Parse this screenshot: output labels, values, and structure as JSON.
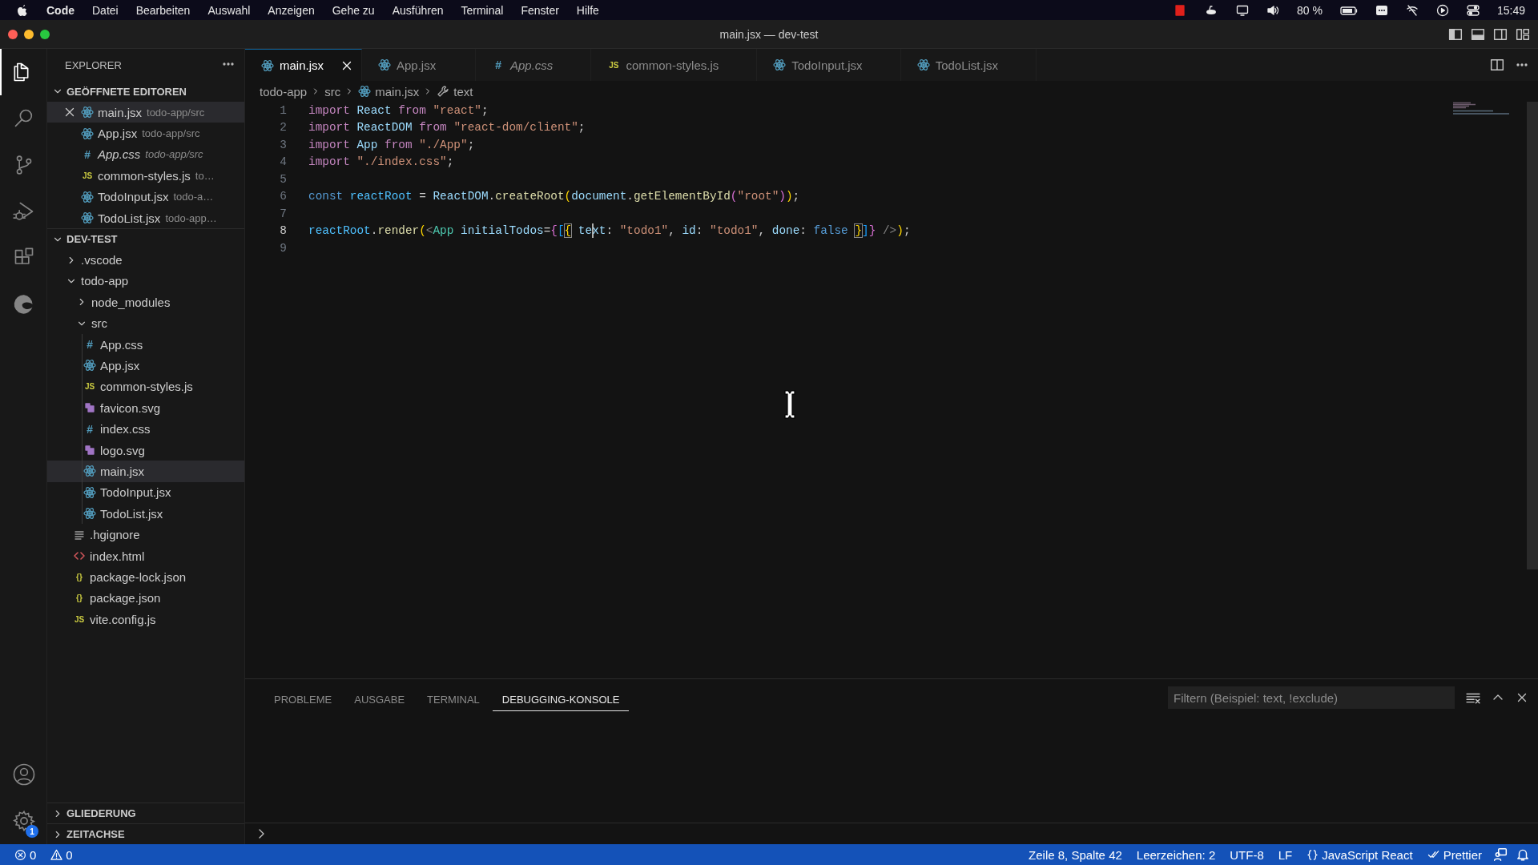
{
  "menubar": {
    "app_name": "Code",
    "menus": [
      "Datei",
      "Bearbeiten",
      "Auswahl",
      "Anzeigen",
      "Gehe zu",
      "Ausführen",
      "Terminal",
      "Fenster",
      "Hilfe"
    ],
    "battery": "80 %",
    "clock": "15:49"
  },
  "window": {
    "title": "main.jsx — dev-test"
  },
  "activity_bar": {
    "items": [
      {
        "kind": "files",
        "selected": true
      },
      {
        "kind": "search",
        "selected": false
      },
      {
        "kind": "source-control",
        "selected": false
      },
      {
        "kind": "run-debug",
        "selected": false
      },
      {
        "kind": "extensions",
        "selected": false
      },
      {
        "kind": "edge",
        "selected": false
      }
    ],
    "settings_badge": "1"
  },
  "sidebar": {
    "title": "EXPLORER",
    "open_editors": {
      "title": "GEÖFFNETE EDITOREN",
      "expanded": true,
      "items": [
        {
          "name": "main.jsx",
          "path": "todo-app/src",
          "kind": "react",
          "selected": true,
          "preview": false
        },
        {
          "name": "App.jsx",
          "path": "todo-app/src",
          "kind": "react",
          "selected": false,
          "preview": false
        },
        {
          "name": "App.css",
          "path": "todo-app/src",
          "kind": "css",
          "icon_text": "#",
          "selected": false,
          "preview": true
        },
        {
          "name": "common-styles.js",
          "path": "to…",
          "kind": "js",
          "icon_text": "JS",
          "selected": false,
          "preview": false
        },
        {
          "name": "TodoInput.jsx",
          "path": "todo-a…",
          "kind": "react",
          "selected": false,
          "preview": false
        },
        {
          "name": "TodoList.jsx",
          "path": "todo-app…",
          "kind": "react",
          "selected": false,
          "preview": false
        }
      ]
    },
    "workspace": {
      "title": "DEV-TEST",
      "expanded": true,
      "items": [
        {
          "name": ".vscode",
          "kind": "folder",
          "expanded": false,
          "selected": false
        },
        {
          "name": "todo-app",
          "kind": "folder",
          "expanded": true,
          "selected": false,
          "children": [
            {
              "name": "node_modules",
              "kind": "folder",
              "expanded": false,
              "selected": false
            },
            {
              "name": "src",
              "kind": "folder",
              "expanded": true,
              "selected": false,
              "children": [
                {
                  "name": "App.css",
                  "kind": "css",
                  "icon_text": "#",
                  "selected": false
                },
                {
                  "name": "App.jsx",
                  "kind": "react",
                  "selected": false
                },
                {
                  "name": "common-styles.js",
                  "kind": "js",
                  "icon_text": "JS",
                  "selected": false
                },
                {
                  "name": "favicon.svg",
                  "kind": "svg",
                  "selected": false
                },
                {
                  "name": "index.css",
                  "kind": "css",
                  "icon_text": "#",
                  "selected": false
                },
                {
                  "name": "logo.svg",
                  "kind": "svg",
                  "selected": false
                },
                {
                  "name": "main.jsx",
                  "kind": "react",
                  "selected": true
                },
                {
                  "name": "TodoInput.jsx",
                  "kind": "react",
                  "selected": false
                },
                {
                  "name": "TodoList.jsx",
                  "kind": "react",
                  "selected": false
                }
              ]
            },
            {
              "name": ".hgignore",
              "kind": "lines",
              "selected": false
            },
            {
              "name": "index.html",
              "kind": "html",
              "selected": false
            },
            {
              "name": "package-lock.json",
              "kind": "json",
              "icon_text": "{}",
              "selected": false
            },
            {
              "name": "package.json",
              "kind": "json",
              "icon_text": "{}",
              "selected": false
            },
            {
              "name": "vite.config.js",
              "kind": "js",
              "icon_text": "JS",
              "selected": false
            }
          ]
        }
      ]
    },
    "sections": [
      {
        "title": "GLIEDERUNG",
        "expanded": false
      },
      {
        "title": "ZEITACHSE",
        "expanded": false
      }
    ]
  },
  "tabs": [
    {
      "label": "main.jsx",
      "kind": "react",
      "selected": true,
      "preview": false
    },
    {
      "label": "App.jsx",
      "kind": "react",
      "selected": false,
      "preview": false
    },
    {
      "label": "App.css",
      "kind": "css",
      "icon_text": "#",
      "selected": false,
      "preview": true
    },
    {
      "label": "common-styles.js",
      "kind": "js",
      "icon_text": "JS",
      "selected": false,
      "preview": false
    },
    {
      "label": "TodoInput.jsx",
      "kind": "react",
      "selected": false,
      "preview": false
    },
    {
      "label": "TodoList.jsx",
      "kind": "react",
      "selected": false,
      "preview": false
    }
  ],
  "breadcrumb": [
    {
      "label": "todo-app",
      "kind": "folder"
    },
    {
      "label": "src",
      "kind": "folder"
    },
    {
      "label": "main.jsx",
      "kind": "react"
    },
    {
      "label": "text",
      "kind": "wrench"
    }
  ],
  "code": [
    {
      "number": "1",
      "active": false,
      "tokens": [
        {
          "t": "import ",
          "kind": "kw"
        },
        {
          "t": "React ",
          "kind": "var"
        },
        {
          "t": "from ",
          "kind": "kw"
        },
        {
          "t": "\"react\"",
          "kind": "str"
        },
        {
          "t": ";",
          "kind": "plain"
        }
      ]
    },
    {
      "number": "2",
      "active": false,
      "tokens": [
        {
          "t": "import ",
          "kind": "kw"
        },
        {
          "t": "ReactDOM ",
          "kind": "var"
        },
        {
          "t": "from ",
          "kind": "kw"
        },
        {
          "t": "\"react-dom/client\"",
          "kind": "str"
        },
        {
          "t": ";",
          "kind": "plain"
        }
      ]
    },
    {
      "number": "3",
      "active": false,
      "tokens": [
        {
          "t": "import ",
          "kind": "kw"
        },
        {
          "t": "App ",
          "kind": "var"
        },
        {
          "t": "from ",
          "kind": "kw"
        },
        {
          "t": "\"./App\"",
          "kind": "str"
        },
        {
          "t": ";",
          "kind": "plain"
        }
      ]
    },
    {
      "number": "4",
      "active": false,
      "tokens": [
        {
          "t": "import ",
          "kind": "kw"
        },
        {
          "t": "\"./index.css\"",
          "kind": "str"
        },
        {
          "t": ";",
          "kind": "plain"
        }
      ]
    },
    {
      "number": "5",
      "active": false
    },
    {
      "number": "6",
      "active": false,
      "tokens": [
        {
          "t": "const ",
          "kind": "decl"
        },
        {
          "t": "reactRoot",
          "kind": "const"
        },
        {
          "t": " = ",
          "kind": "plain"
        },
        {
          "t": "ReactDOM",
          "kind": "var"
        },
        {
          "t": ".",
          "kind": "plain"
        },
        {
          "t": "createRoot",
          "kind": "fn"
        },
        {
          "t": "(",
          "kind": "b1"
        },
        {
          "t": "document",
          "kind": "var"
        },
        {
          "t": ".",
          "kind": "plain"
        },
        {
          "t": "getElementById",
          "kind": "fn"
        },
        {
          "t": "(",
          "kind": "b2"
        },
        {
          "t": "\"root\"",
          "kind": "str"
        },
        {
          "t": ")",
          "kind": "b2"
        },
        {
          "t": ")",
          "kind": "b1"
        },
        {
          "t": ";",
          "kind": "plain"
        }
      ]
    },
    {
      "number": "7",
      "active": false
    },
    {
      "number": "8",
      "active": true,
      "tokens": [
        {
          "t": "reactRoot",
          "kind": "const"
        },
        {
          "t": ".",
          "kind": "plain"
        },
        {
          "t": "render",
          "kind": "fn"
        },
        {
          "t": "(",
          "kind": "b1"
        },
        {
          "t": "<",
          "kind": "punct"
        },
        {
          "t": "App ",
          "kind": "comp"
        },
        {
          "t": "initialTodos",
          "kind": "var"
        },
        {
          "t": "=",
          "kind": "plain"
        },
        {
          "t": "{",
          "kind": "b2"
        },
        {
          "t": "[",
          "kind": "b3"
        },
        {
          "t": "{",
          "kind": "b1m"
        },
        {
          "t": " te",
          "kind": "var"
        },
        {
          "kind": "caret"
        },
        {
          "t": "xt",
          "kind": "var"
        },
        {
          "t": ": ",
          "kind": "plain"
        },
        {
          "t": "\"todo1\"",
          "kind": "str"
        },
        {
          "t": ", ",
          "kind": "plain"
        },
        {
          "t": "id",
          "kind": "var"
        },
        {
          "t": ": ",
          "kind": "plain"
        },
        {
          "t": "\"todo1\"",
          "kind": "str"
        },
        {
          "t": ", ",
          "kind": "plain"
        },
        {
          "t": "done",
          "kind": "var"
        },
        {
          "t": ": ",
          "kind": "plain"
        },
        {
          "t": "false ",
          "kind": "bool"
        },
        {
          "t": "}",
          "kind": "b1m"
        },
        {
          "t": "]",
          "kind": "b3"
        },
        {
          "t": "}",
          "kind": "b2"
        },
        {
          "t": " />",
          "kind": "punct"
        },
        {
          "t": ")",
          "kind": "b1"
        },
        {
          "t": ";",
          "kind": "plain"
        }
      ]
    },
    {
      "number": "9",
      "active": false
    }
  ],
  "panel": {
    "tabs": [
      {
        "label": "PROBLEME",
        "selected": false
      },
      {
        "label": "AUSGABE",
        "selected": false
      },
      {
        "label": "TERMINAL",
        "selected": false
      },
      {
        "label": "DEBUGGING-KONSOLE",
        "selected": true
      }
    ],
    "filter": {
      "placeholder": "Filtern (Beispiel: text, !exclude)"
    }
  },
  "status_bar": {
    "errors": "0",
    "warnings": "0",
    "items": [
      {
        "text": "Zeile 8, Spalte 42",
        "kind": "plain"
      },
      {
        "text": "Leerzeichen: 2",
        "kind": "plain"
      },
      {
        "text": "UTF-8",
        "kind": "plain"
      },
      {
        "text": "LF",
        "kind": "plain"
      },
      {
        "text": "JavaScript React",
        "kind": "braces"
      },
      {
        "text": "Prettier",
        "kind": "double-check"
      }
    ]
  }
}
